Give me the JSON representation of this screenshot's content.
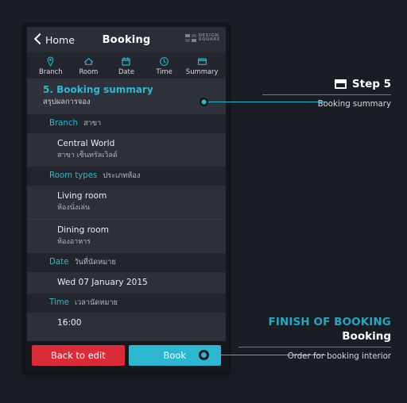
{
  "phone": {
    "topbar": {
      "back_label": "Home",
      "back_icon": "chevron-left-icon",
      "title": "Booking",
      "logo_line1": "DESIGN",
      "logo_line2": "SQUARE"
    },
    "stepnav": [
      {
        "label": "Branch",
        "icon": "location-pin-icon"
      },
      {
        "label": "Room",
        "icon": "home-icon"
      },
      {
        "label": "Date",
        "icon": "calendar-icon"
      },
      {
        "label": "Time",
        "icon": "clock-icon"
      },
      {
        "label": "Summary",
        "icon": "window-icon"
      }
    ],
    "section": {
      "title_en": "5. Booking summary",
      "title_th": "สรุปผลการจอง"
    },
    "groups": [
      {
        "label_en": "Branch",
        "label_th": "สาขา",
        "items": [
          {
            "en": "Central World",
            "th": "สาขา เซ็นทรัลเวิลด์"
          }
        ]
      },
      {
        "label_en": "Room types",
        "label_th": "ประเภทห้อง",
        "items": [
          {
            "en": "Living room",
            "th": "ห้องนั่งเล่น"
          },
          {
            "en": "Dining room",
            "th": "ห้องอาหาร"
          }
        ]
      },
      {
        "label_en": "Date",
        "label_th": "วันที่นัดหมาย",
        "value": "Wed 07 January 2015"
      },
      {
        "label_en": "Time",
        "label_th": "เวลานัดหมาย",
        "value": "16:00"
      }
    ],
    "footer": {
      "back_button": "Back to edit",
      "book_button": "Book"
    }
  },
  "annotations": {
    "top": {
      "icon": "window-icon",
      "title": "Step 5",
      "subtitle": "Booking summary"
    },
    "bottom": {
      "kicker": "FINISH OF BOOKING",
      "title": "Booking",
      "subtitle": "Order for booking interior"
    }
  },
  "colors": {
    "accent": "#2bb7cf",
    "danger": "#dc2b38",
    "page_bg": "#1a1d23",
    "panel": "#2d3038"
  }
}
